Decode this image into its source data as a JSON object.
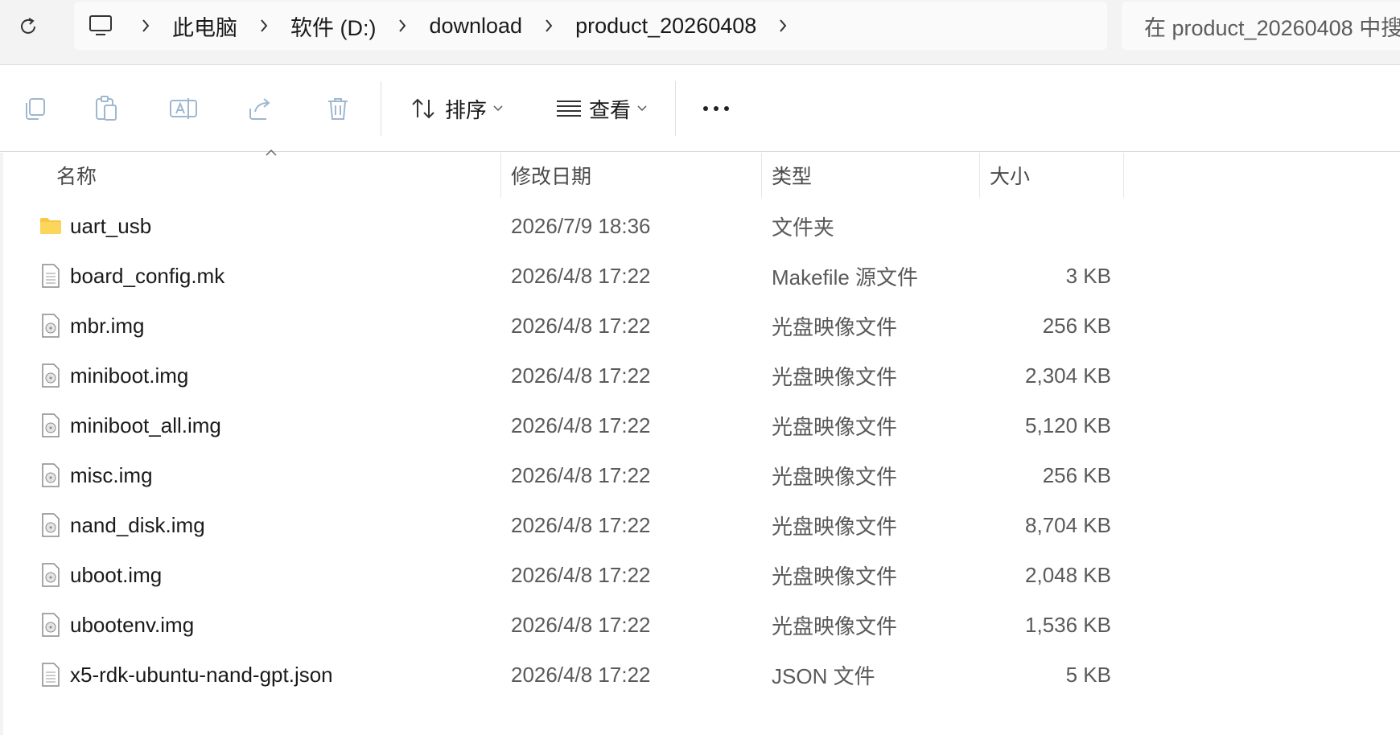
{
  "address_bar": {
    "breadcrumbs": [
      "此电脑",
      "软件 (D:)",
      "download",
      "product_20260408"
    ],
    "search_placeholder": "在 product_20260408 中搜"
  },
  "toolbar": {
    "sort_label": "排序",
    "view_label": "查看"
  },
  "columns": {
    "name": "名称",
    "modified": "修改日期",
    "type": "类型",
    "size": "大小"
  },
  "files": [
    {
      "name": "uart_usb",
      "date": "2026/7/9 18:36",
      "type": "文件夹",
      "size": "",
      "icon": "folder-icon"
    },
    {
      "name": "board_config.mk",
      "date": "2026/4/8 17:22",
      "type": "Makefile 源文件",
      "size": "3 KB",
      "icon": "text-file-icon"
    },
    {
      "name": "mbr.img",
      "date": "2026/4/8 17:22",
      "type": "光盘映像文件",
      "size": "256 KB",
      "icon": "disc-image-icon"
    },
    {
      "name": "miniboot.img",
      "date": "2026/4/8 17:22",
      "type": "光盘映像文件",
      "size": "2,304 KB",
      "icon": "disc-image-icon"
    },
    {
      "name": "miniboot_all.img",
      "date": "2026/4/8 17:22",
      "type": "光盘映像文件",
      "size": "5,120 KB",
      "icon": "disc-image-icon"
    },
    {
      "name": "misc.img",
      "date": "2026/4/8 17:22",
      "type": "光盘映像文件",
      "size": "256 KB",
      "icon": "disc-image-icon"
    },
    {
      "name": "nand_disk.img",
      "date": "2026/4/8 17:22",
      "type": "光盘映像文件",
      "size": "8,704 KB",
      "icon": "disc-image-icon"
    },
    {
      "name": "uboot.img",
      "date": "2026/4/8 17:22",
      "type": "光盘映像文件",
      "size": "2,048 KB",
      "icon": "disc-image-icon"
    },
    {
      "name": "ubootenv.img",
      "date": "2026/4/8 17:22",
      "type": "光盘映像文件",
      "size": "1,536 KB",
      "icon": "disc-image-icon"
    },
    {
      "name": "x5-rdk-ubuntu-nand-gpt.json",
      "date": "2026/4/8 17:22",
      "type": "JSON 文件",
      "size": "5 KB",
      "icon": "text-file-icon"
    }
  ],
  "colors": {
    "folder": "#f8c843",
    "toolbar_disabled_icon": "#9fb7cf",
    "text_secondary": "#5a5a5a"
  }
}
